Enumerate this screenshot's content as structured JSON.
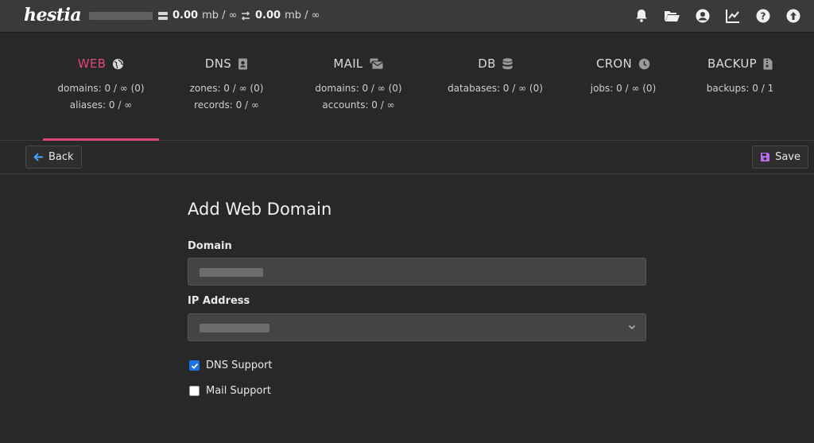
{
  "app": {
    "logo": "hestia"
  },
  "topbar": {
    "disk_value": "0.00",
    "disk_unit": "mb / ∞",
    "bandwidth_value": "0.00",
    "bandwidth_unit": "mb / ∞",
    "icons": [
      "bell-icon",
      "folder-open-icon",
      "user-circle-icon",
      "chart-line-icon",
      "help-icon",
      "upload-icon"
    ]
  },
  "tabs": [
    {
      "title": "WEB",
      "icon": "globe-icon",
      "line1": "domains: 0 / ∞ (0)",
      "line2": "aliases: 0 / ∞",
      "active": true
    },
    {
      "title": "DNS",
      "icon": "address-book-icon",
      "line1": "zones: 0 / ∞ (0)",
      "line2": "records: 0 / ∞",
      "active": false
    },
    {
      "title": "MAIL",
      "icon": "mail-bulk-icon",
      "line1": "domains: 0 / ∞ (0)",
      "line2": "accounts: 0 / ∞",
      "active": false
    },
    {
      "title": "DB",
      "icon": "database-icon",
      "line1": "databases: 0 / ∞ (0)",
      "line2": "",
      "active": false
    },
    {
      "title": "CRON",
      "icon": "clock-icon",
      "line1": "jobs: 0 / ∞ (0)",
      "line2": "",
      "active": false
    },
    {
      "title": "BACKUP",
      "icon": "file-archive-icon",
      "line1": "backups: 0 / 1",
      "line2": "",
      "active": false
    }
  ],
  "toolbar": {
    "back_label": "Back",
    "save_label": "Save"
  },
  "form": {
    "title": "Add Web Domain",
    "domain_label": "Domain",
    "ip_label": "IP Address",
    "dns_support_label": "DNS Support",
    "dns_support_checked": true,
    "mail_support_label": "Mail Support",
    "mail_support_checked": false
  },
  "colors": {
    "accent": "#e0497a",
    "save_icon": "#b56bf0",
    "back_icon": "#4aa3ff",
    "checkbox": "#1a73e8"
  }
}
